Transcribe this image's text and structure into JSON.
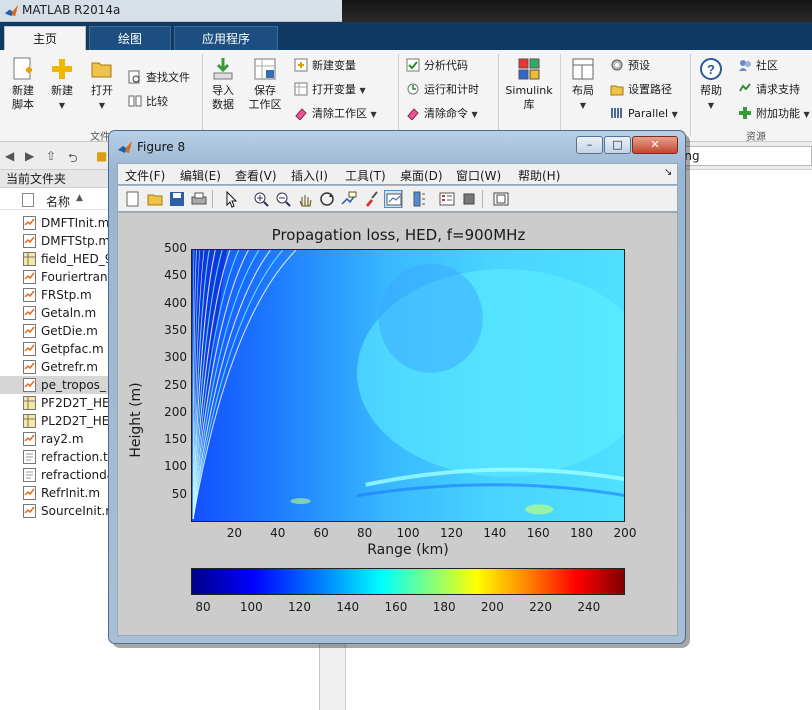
{
  "app": {
    "title": "MATLAB R2014a"
  },
  "tabs": [
    {
      "label": "主页"
    },
    {
      "label": "绘图"
    },
    {
      "label": "应用程序"
    }
  ],
  "ribbon": {
    "new_script": "新建\n脚本",
    "new": "新建",
    "open": "打开",
    "find_files": "查找文件",
    "compare": "比较",
    "import_data": "导入\n数据",
    "save_workspace": "保存\n工作区",
    "new_variable": "新建变量",
    "open_variable": "打开变量",
    "clear_workspace": "清除工作区",
    "analyze_code": "分析代码",
    "run_and_time": "运行和计时",
    "clear_commands": "清除命令",
    "simulink": "Simulink\n库",
    "layout": "布局",
    "preferences": "预设",
    "set_path": "设置路径",
    "parallel": "Parallel",
    "help": "帮助",
    "community": "社区",
    "request_support": "请求支持",
    "add_ons": "附加功能",
    "group_file": "文件",
    "group_resources": "资源"
  },
  "address": {
    "path_fragment": "ing"
  },
  "file_panel": {
    "title": "当前文件夹",
    "column_name": "名称",
    "files": [
      {
        "name": "DMFTInit.m",
        "type": "m"
      },
      {
        "name": "DMFTStp.m",
        "type": "m"
      },
      {
        "name": "field_HED_9",
        "type": "fig"
      },
      {
        "name": "Fouriertrans",
        "type": "m"
      },
      {
        "name": "FRStp.m",
        "type": "m"
      },
      {
        "name": "Getaln.m",
        "type": "m"
      },
      {
        "name": "GetDie.m",
        "type": "m"
      },
      {
        "name": "Getpfac.m",
        "type": "m"
      },
      {
        "name": "Getrefr.m",
        "type": "m"
      },
      {
        "name": "pe_tropos_",
        "type": "m",
        "selected": true
      },
      {
        "name": "PF2D2T_HE",
        "type": "fig"
      },
      {
        "name": "PL2D2T_HE",
        "type": "fig"
      },
      {
        "name": "ray2.m",
        "type": "m"
      },
      {
        "name": "refraction.t",
        "type": "txt"
      },
      {
        "name": "refractionda",
        "type": "txt"
      },
      {
        "name": "RefrInit.m",
        "type": "m"
      },
      {
        "name": "SourceInit.m",
        "type": "m"
      }
    ]
  },
  "figure": {
    "title": "Figure 8",
    "menu": [
      "文件(F)",
      "编辑(E)",
      "查看(V)",
      "插入(I)",
      "工具(T)",
      "桌面(D)",
      "窗口(W)",
      "帮助(H)"
    ],
    "toolbar_icons": [
      "new-figure-icon",
      "open-file-icon",
      "save-icon",
      "print-icon",
      "pointer-icon",
      "zoom-in-icon",
      "zoom-out-icon",
      "pan-icon",
      "rotate-icon",
      "data-cursor-icon",
      "brush-icon",
      "link-plot-icon",
      "colorbar-icon",
      "legend-icon",
      "hide-plot-tools-icon",
      "show-plot-tools-icon"
    ]
  },
  "chart_data": [
    {
      "type": "heatmap",
      "title": "Propagation loss, HED, f=900MHz",
      "xlabel": "Range (km)",
      "ylabel": "Height (m)",
      "xlim": [
        0,
        200
      ],
      "ylim": [
        0,
        500
      ],
      "xticks": [
        "20",
        "40",
        "60",
        "80",
        "100",
        "120",
        "140",
        "160",
        "180",
        "200"
      ],
      "yticks": [
        "50",
        "100",
        "150",
        "200",
        "250",
        "300",
        "350",
        "400",
        "450",
        "500"
      ],
      "colormap": "jet",
      "clim": [
        75,
        255
      ],
      "dominant_value_range": [
        100,
        145
      ],
      "features": [
        "interference fringes fanning out from the source near x=0",
        "horizontal duct layer near height 80-100 m from 80 to 200 km",
        "lighter cyan region at large range and mid height"
      ]
    },
    {
      "type": "colorbar",
      "ticks": [
        "80",
        "100",
        "120",
        "140",
        "160",
        "180",
        "200",
        "220",
        "240"
      ],
      "range": [
        75,
        255
      ]
    }
  ],
  "colors": {
    "tabstrip": "#0e3a63",
    "figure_canvas": "#cccccc",
    "close_button": "#c4452d"
  }
}
